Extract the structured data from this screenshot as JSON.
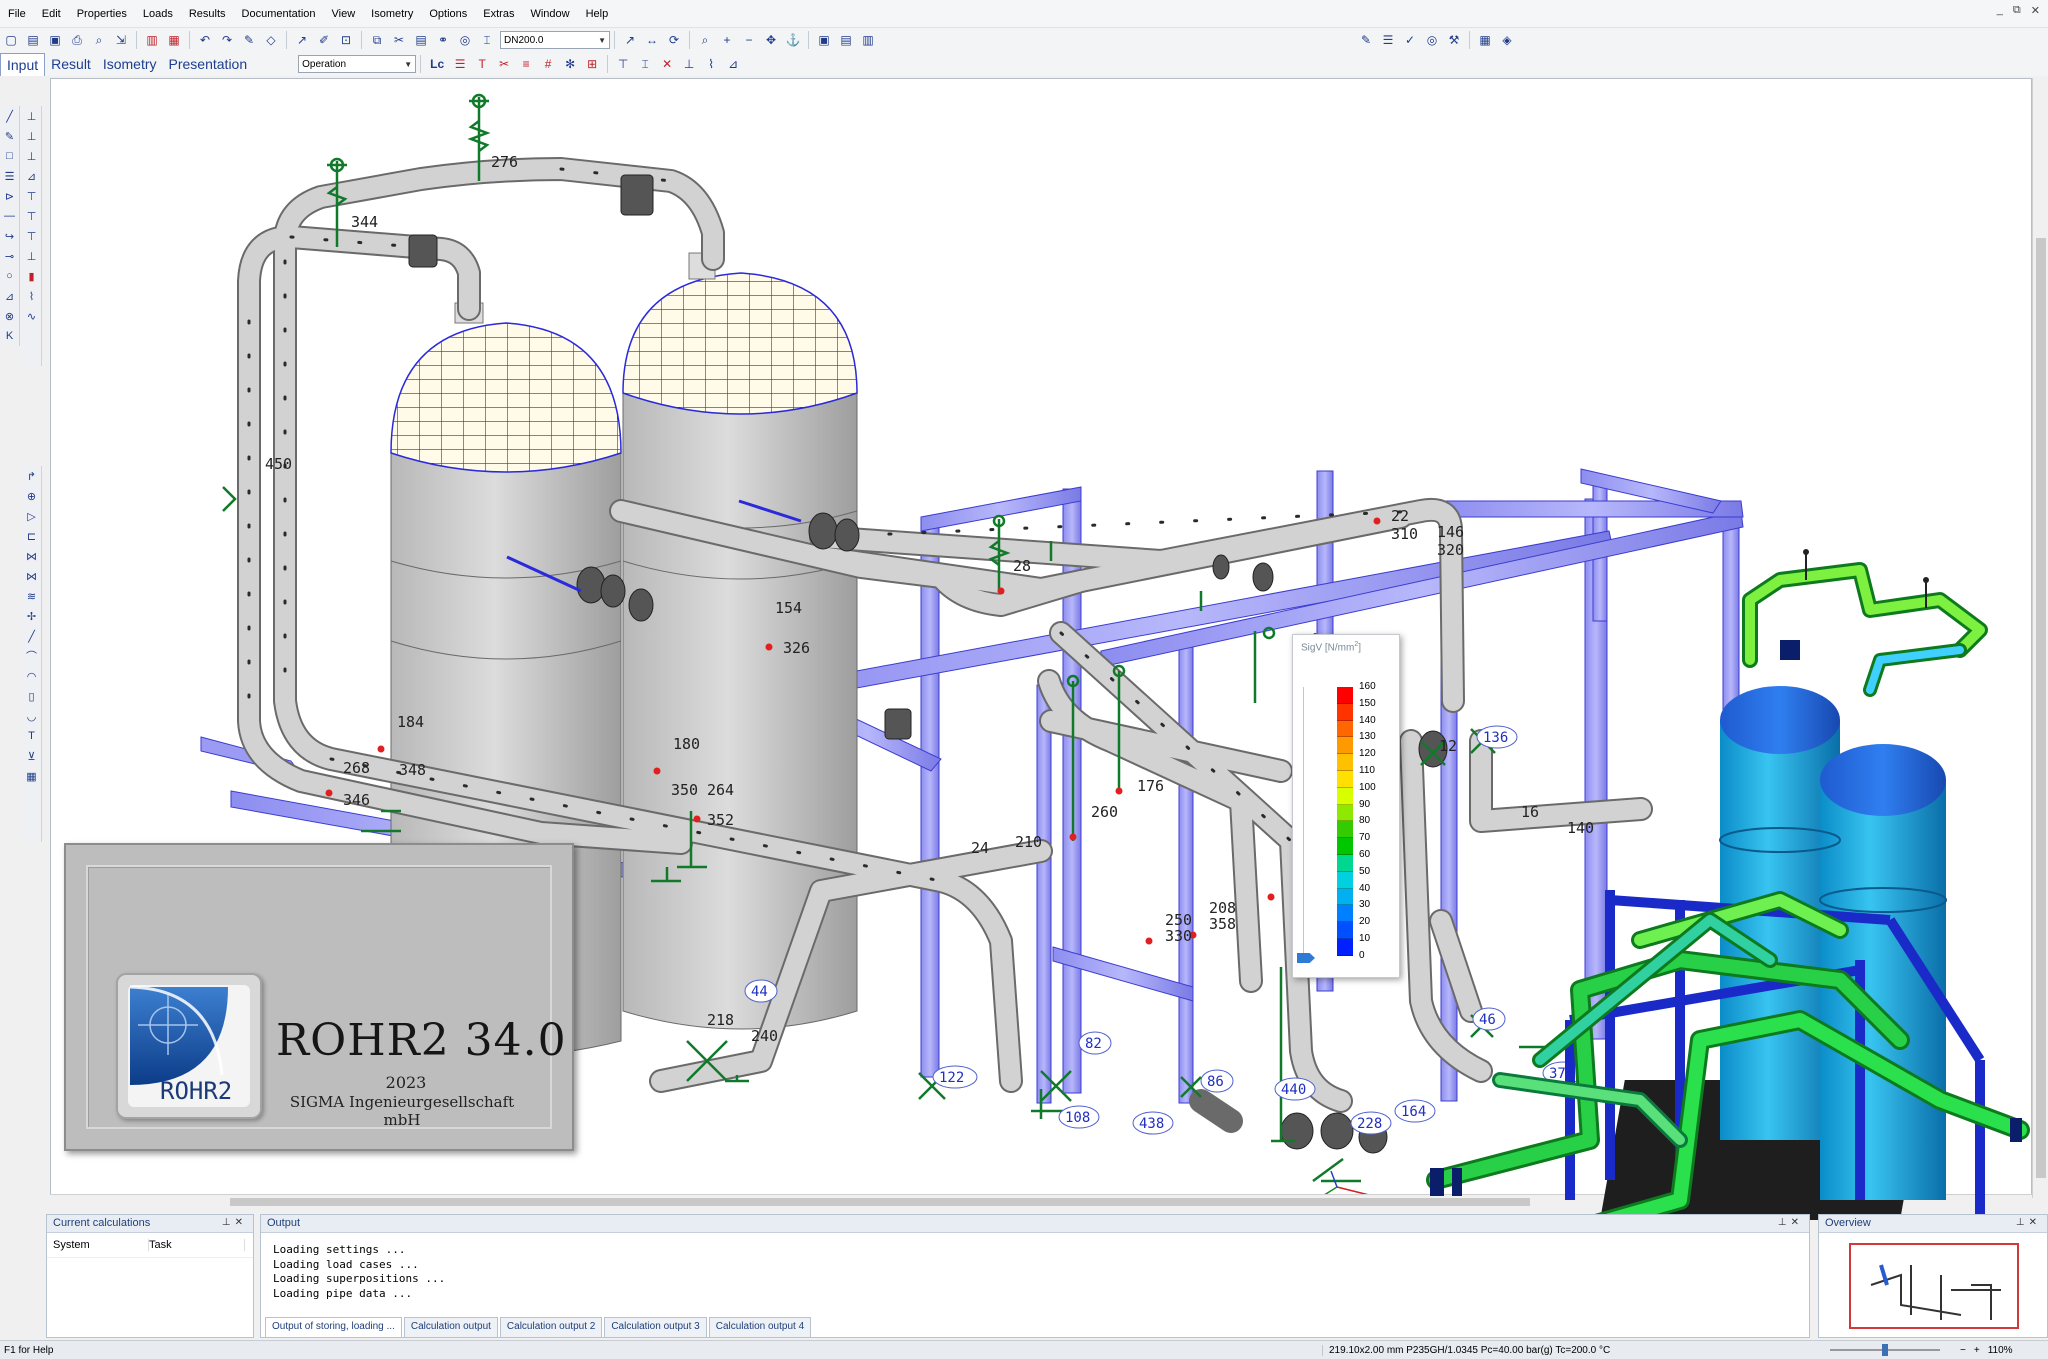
{
  "menu": {
    "items": [
      "File",
      "Edit",
      "Properties",
      "Loads",
      "Results",
      "Documentation",
      "View",
      "Isometry",
      "Options",
      "Extras",
      "Window",
      "Help"
    ],
    "window_controls": [
      "_",
      "⧉",
      "✕"
    ]
  },
  "toolbar": {
    "dn_value": "DN200.0",
    "mode_tabs": [
      "Input",
      "Result",
      "Isometry",
      "Presentation"
    ],
    "loadcase_value": "Operation",
    "lc_label": "Lc"
  },
  "legend": {
    "title": "SigV [N/mm",
    "title_sup": "2",
    "title_end": "]",
    "levels": [
      "160",
      "150",
      "140",
      "130",
      "120",
      "110",
      "100",
      "90",
      "80",
      "70",
      "60",
      "50",
      "40",
      "30",
      "20",
      "10",
      "0"
    ],
    "colors": [
      "#ff0000",
      "#ff3300",
      "#ff6600",
      "#ff9900",
      "#ffc000",
      "#ffe000",
      "#d8ff00",
      "#8fe800",
      "#33cc00",
      "#00c600",
      "#00d890",
      "#00d0e0",
      "#00b0f0",
      "#0080ff",
      "#0050ff",
      "#0020ff",
      "#0000c0"
    ]
  },
  "node_labels": [
    "276",
    "344",
    "450",
    "28",
    "22",
    "310",
    "146",
    "320",
    "154",
    "326",
    "184",
    "268",
    "348",
    "346",
    "180",
    "350",
    "264",
    "352",
    "176",
    "260",
    "210",
    "24",
    "250",
    "208",
    "330",
    "358",
    "136",
    "16",
    "140",
    "12",
    "46",
    "44",
    "218",
    "240",
    "82",
    "122",
    "108",
    "438",
    "86",
    "440",
    "228",
    "164",
    "374"
  ],
  "splash": {
    "product": "ROHR2 34.0",
    "year": "2023",
    "company": "SIGMA Ingenieurgesellschaft mbH",
    "logo_text": "ROHR2"
  },
  "panels": {
    "calc": {
      "title": "Current calculations",
      "columns": [
        "System",
        "Task"
      ]
    },
    "output": {
      "title": "Output",
      "lines": [
        "Loading settings ...",
        "Loading load cases ...",
        "Loading superpositions ...",
        "Loading pipe data ..."
      ],
      "tabs": [
        "Output of storing, loading ...",
        "Calculation output",
        "Calculation output 2",
        "Calculation output 3",
        "Calculation output 4"
      ]
    },
    "overview": {
      "title": "Overview"
    }
  },
  "status": {
    "help": "F1 for Help",
    "info": "219.10x2.00 mm P235GH/1.0345 Pc=40.00 bar(g) Tc=200.0 °C",
    "zoom": "110%"
  }
}
